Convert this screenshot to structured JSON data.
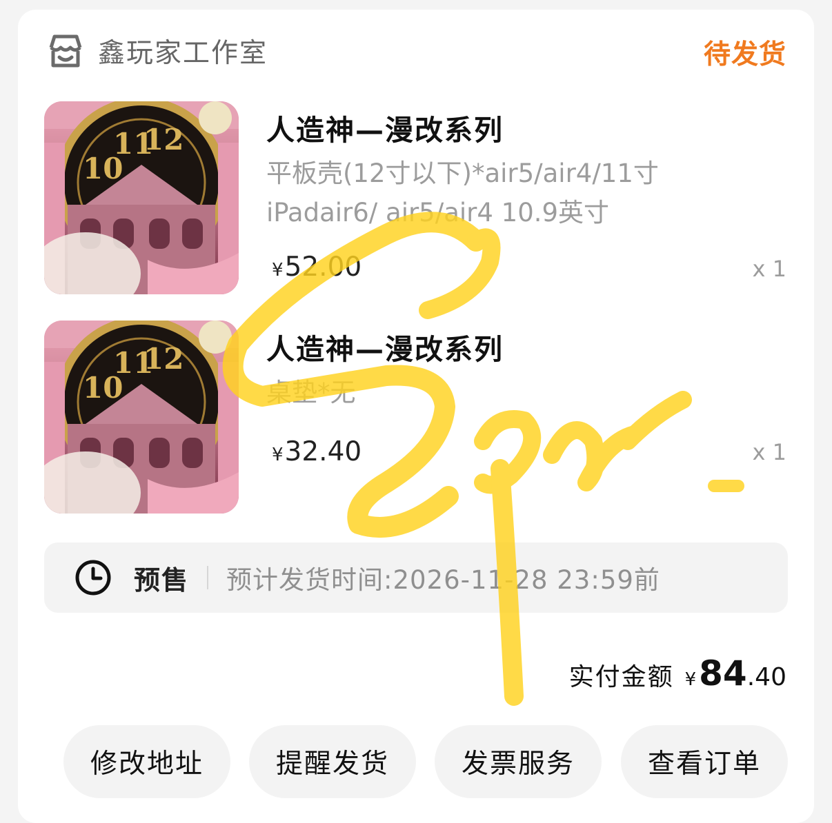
{
  "shop": {
    "name": "鑫玩家工作室",
    "icon": "store-icon",
    "status": "待发货",
    "status_color": "#f07a1f"
  },
  "items": [
    {
      "title": "人造神—漫改系列",
      "spec_line1": "平板壳(12寸以下)*air5/air4/11寸",
      "spec_line2": "iPadair6/ air5/air4 10.9英寸",
      "price_symbol": "¥",
      "price": "52.00",
      "quantity": "x 1"
    },
    {
      "title": "人造神—漫改系列",
      "spec_line1": "桌垫*无",
      "price_symbol": "¥",
      "price": "32.40",
      "quantity": "x 1"
    }
  ],
  "presale": {
    "icon": "clock-icon",
    "label": "预售",
    "text": "预计发货时间:2026-11-28 23:59前"
  },
  "total": {
    "label": "实付金额",
    "symbol": "¥",
    "integer": "84",
    "decimal": ".40"
  },
  "actions": [
    "修改地址",
    "提醒发货",
    "发票服务",
    "查看订单"
  ],
  "overlay": {
    "description": "handwritten-signature",
    "color": "#ffd21f"
  }
}
